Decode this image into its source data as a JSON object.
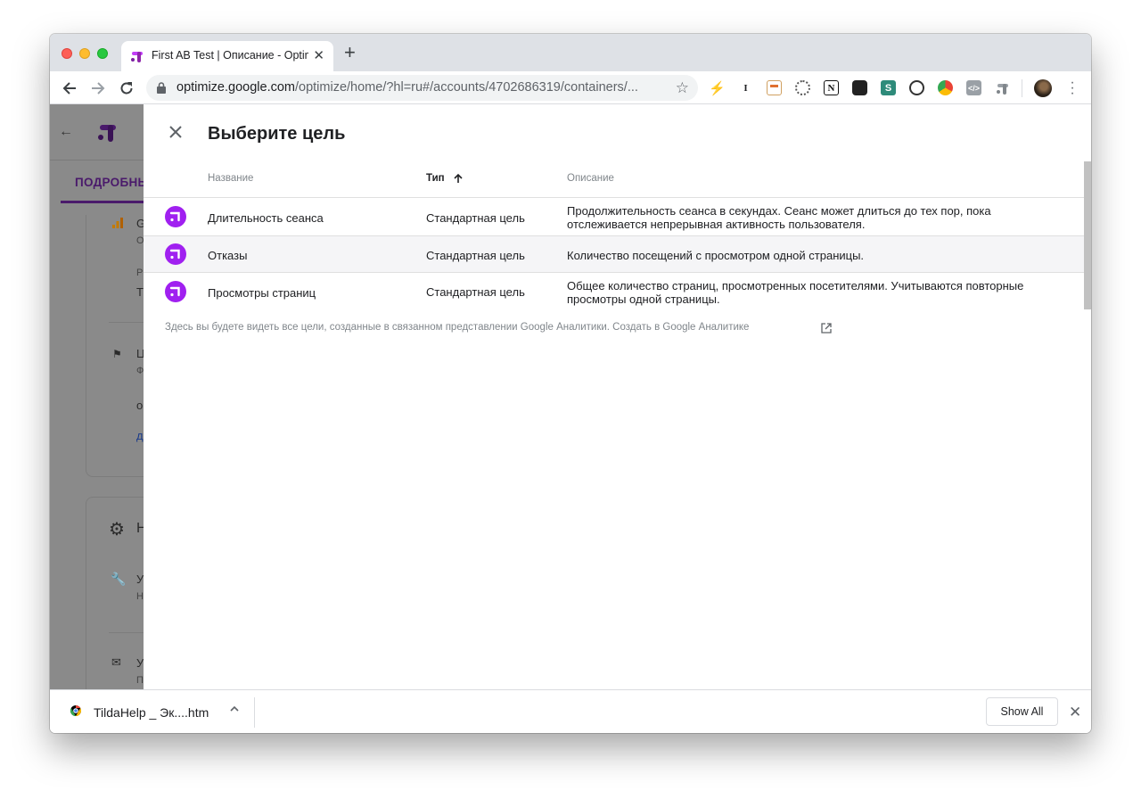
{
  "browser": {
    "tab_title": "First AB Test | Описание - Optimize",
    "url_host": "optimize.google.com",
    "url_path": "/optimize/home/?hl=ru#/accounts/4702686319/containers/..."
  },
  "background_page": {
    "tab_label": "ПОДРОБНЫ",
    "letters": [
      "G",
      "O",
      "P",
      "T",
      "Ц",
      "Ф",
      "о",
      "д",
      "Н",
      "У",
      "Н",
      "У",
      "П"
    ]
  },
  "dialog": {
    "title": "Выберите цель",
    "columns": {
      "name": "Название",
      "type": "Тип",
      "description": "Описание"
    },
    "rows": [
      {
        "name": "Длительность сеанса",
        "type": "Стандартная цель",
        "description_line1": "Продолжительность сеанса в секундах. Сеанс может длиться до тех пор, пока",
        "description_line2": "отслеживается непрерывная активность пользователя."
      },
      {
        "name": "Отказы",
        "type": "Стандартная цель",
        "description_line1": "Количество посещений с просмотром одной страницы.",
        "description_line2": ""
      },
      {
        "name": "Просмотры страниц",
        "type": "Стандартная цель",
        "description_line1": "Общее количество страниц, просмотренных посетителями. Учитываются повторные",
        "description_line2": "просмотры одной страницы."
      }
    ],
    "footer_note": "Здесь вы будете видеть все цели, созданные в связанном представлении Google Аналитики. Создать в Google Аналитике"
  },
  "download_shelf": {
    "file_name": "TildaHelp _ Эк....htm",
    "show_all_label": "Show All"
  },
  "colors": {
    "optimize_purple": "#a020f0",
    "accent_purple": "#4a1a6b"
  },
  "icons": [
    "close-icon",
    "sort-arrow-up-icon",
    "optimize-goal-icon",
    "external-link-icon",
    "back-arrow-icon",
    "forward-arrow-icon",
    "reload-icon",
    "lock-icon",
    "star-icon"
  ]
}
